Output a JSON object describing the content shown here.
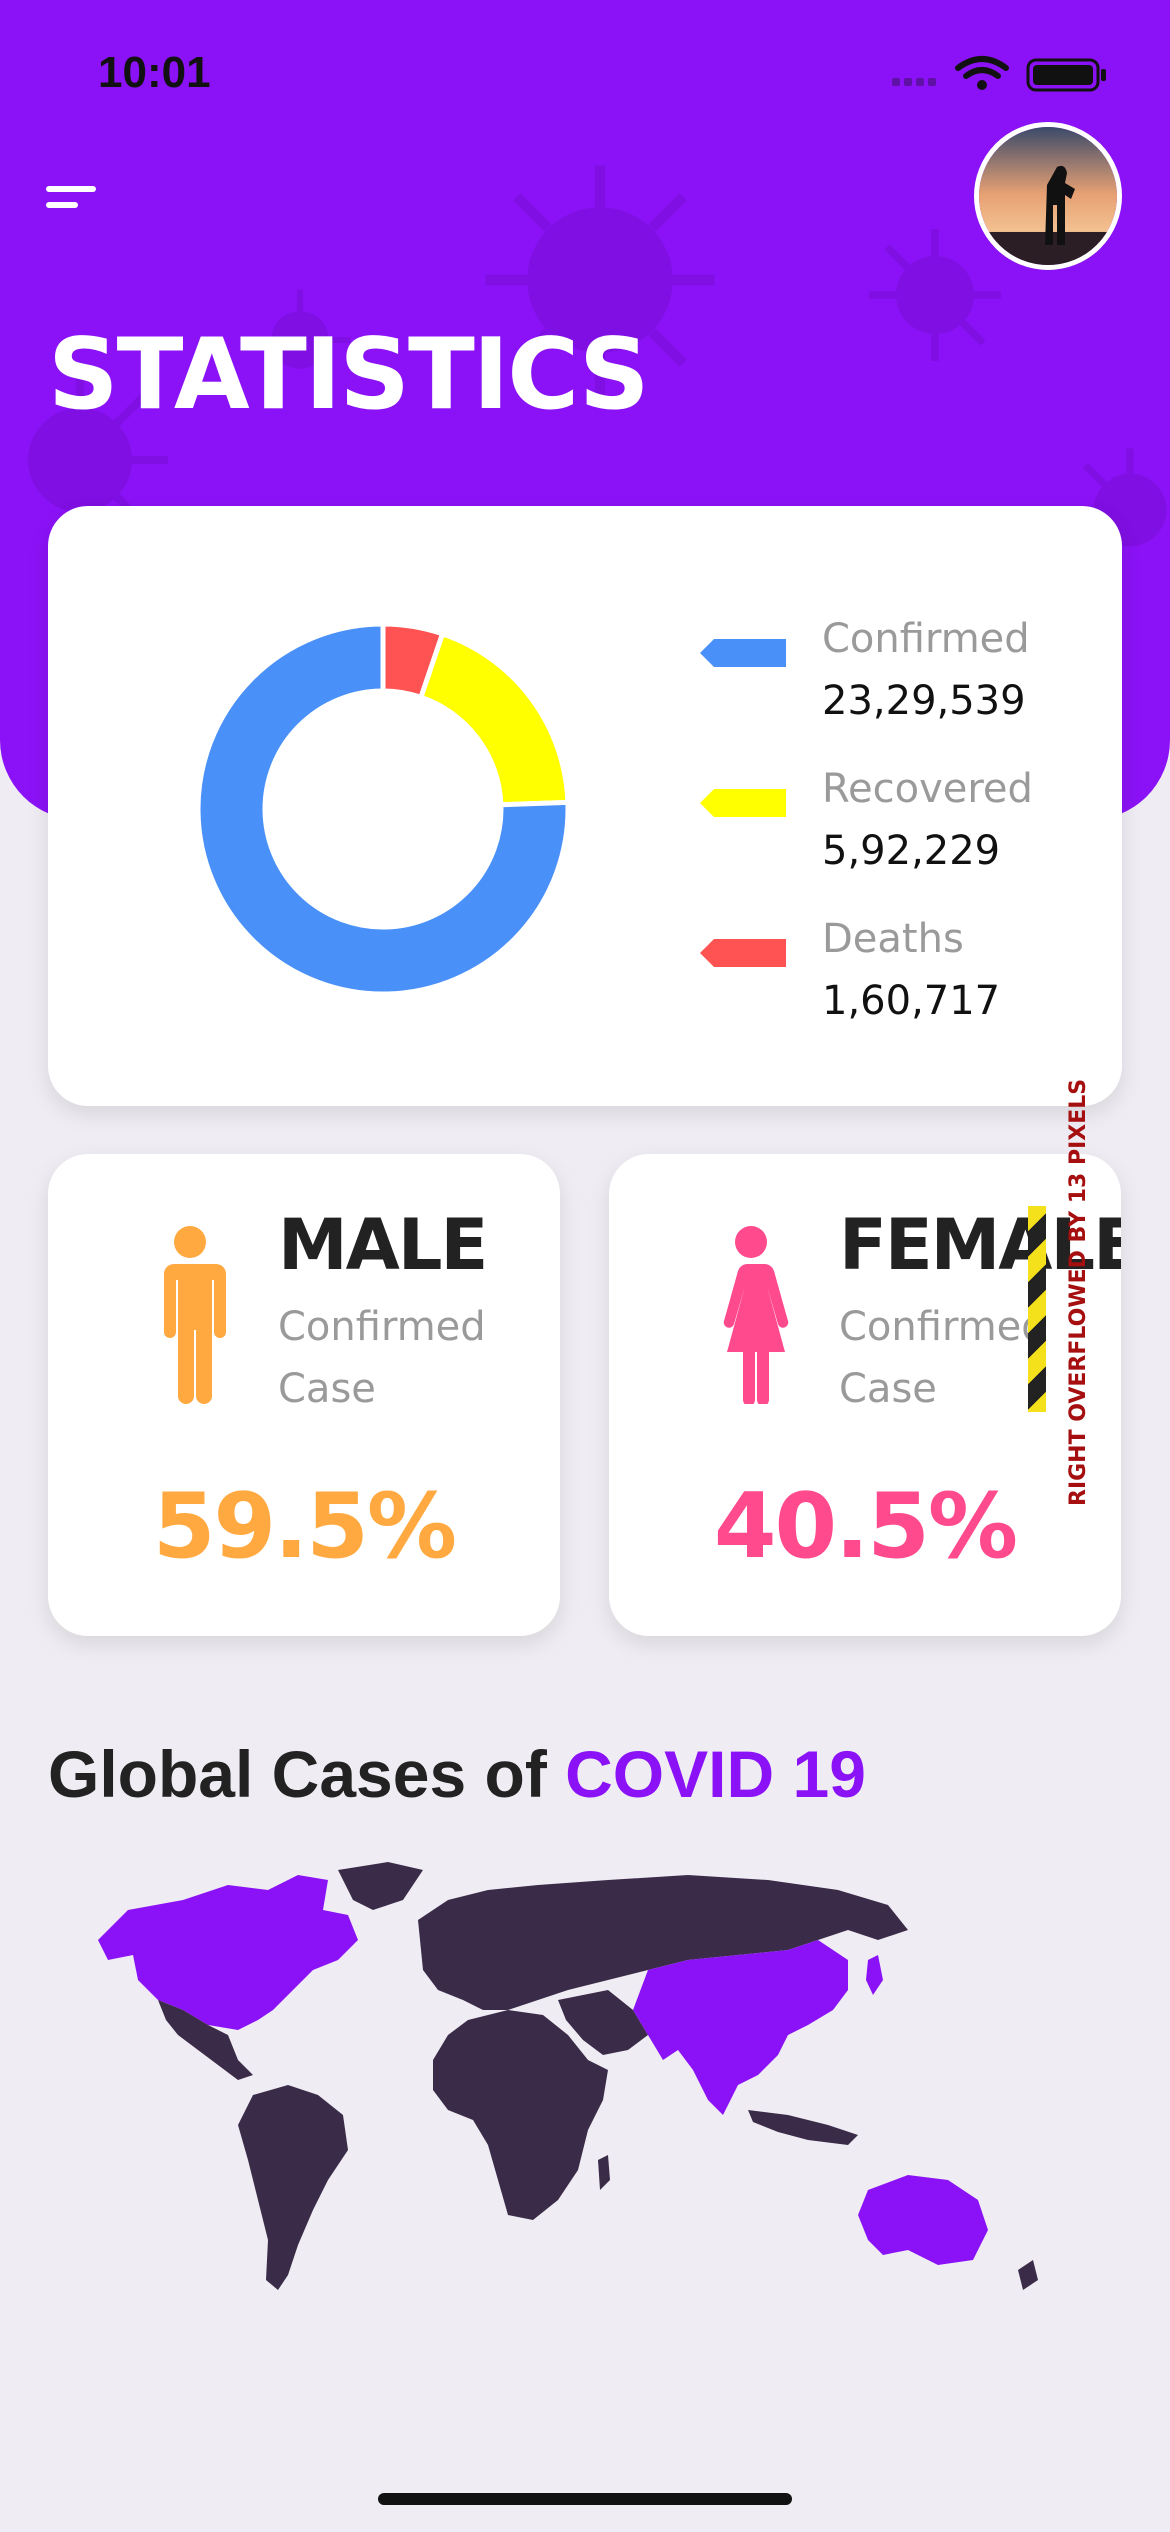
{
  "status_bar": {
    "time": "10:01"
  },
  "header": {
    "title": "STATISTICS"
  },
  "summary": {
    "legend": [
      {
        "label": "Confirmed",
        "value": "23,29,539",
        "color": "#4A90F9"
      },
      {
        "label": "Recovered",
        "value": "5,92,229",
        "color": "#FFFF00"
      },
      {
        "label": "Deaths",
        "value": "1,60,717",
        "color": "#FF5252"
      }
    ]
  },
  "chart_data": {
    "type": "pie",
    "categories": [
      "Confirmed",
      "Recovered",
      "Deaths"
    ],
    "values": [
      2329539,
      592229,
      160717
    ],
    "colors": [
      "#4A90F9",
      "#FFFF00",
      "#FF5252"
    ],
    "title": "",
    "donut": true
  },
  "gender": {
    "male": {
      "title": "MALE",
      "subtitle": "Confirmed Case",
      "percent": "59.5%",
      "color": "#FFA940"
    },
    "female": {
      "title": "FEMALE",
      "subtitle": "Confirmed Case",
      "percent": "40.5%",
      "color": "#FF4A8D"
    }
  },
  "overflow_warning": "RIGHT OVERFLOWED BY 13 PIXELS",
  "global": {
    "title_prefix": "Global Cases of ",
    "title_accent": "COVID 19"
  },
  "colors": {
    "brand": "#8B12F6",
    "map_land": "#3A2B49",
    "map_highlight": "#8B12F6"
  }
}
